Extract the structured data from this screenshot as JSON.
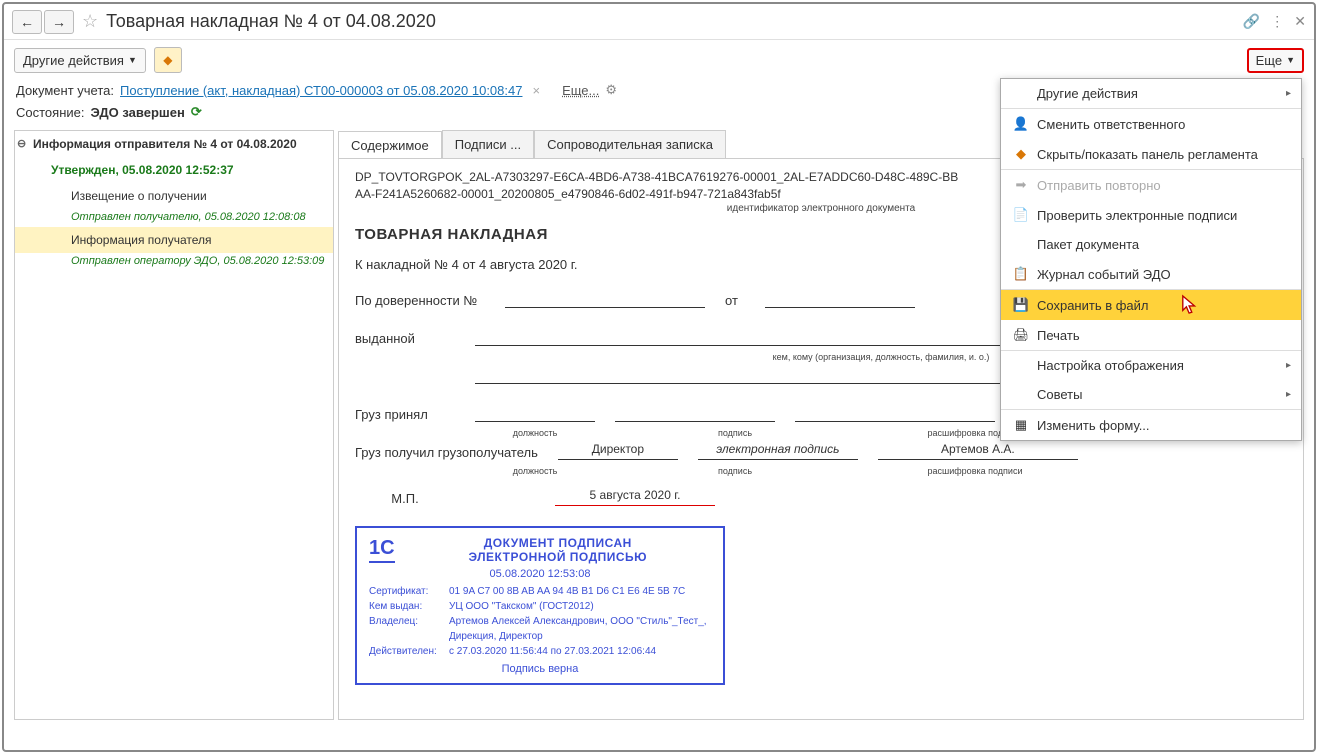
{
  "title": "Товарная накладная № 4 от 04.08.2020",
  "toolbar": {
    "other_actions": "Другие действия",
    "more": "Еще"
  },
  "info": {
    "doc_label": "Документ учета:",
    "doc_link": "Поступление (акт, накладная) СТ00-000003 от 05.08.2020 10:08:47",
    "more": "Еще...",
    "state_label": "Состояние:",
    "state_value": "ЭДО завершен"
  },
  "sidebar": {
    "head": "Информация отправителя № 4 от 04.08.2020",
    "approved": "Утвержден, 05.08.2020 12:52:37",
    "item1": "Извещение о получении",
    "item1_status": "Отправлен получателю, 05.08.2020 12:08:08",
    "item2": "Информация получателя",
    "item2_status": "Отправлен оператору ЭДО, 05.08.2020 12:53:09"
  },
  "tabs": {
    "t1": "Содержимое",
    "t2": "Подписи ...",
    "t3": "Сопроводительная записка"
  },
  "doc": {
    "id_line1": "DP_TOVTORGPOK_2AL-A7303297-E6CA-4BD6-A738-41BCA7619276-00001_2AL-E7ADDC60-D48C-489C-BB",
    "id_line2": "AA-F241A5260682-00001_20200805_e4790846-6d02-491f-b947-721a843fab5f",
    "id_caption": "идентификатор электронного документа",
    "title": "ТОВАРНАЯ НАКЛАДНАЯ",
    "subtitle": "К накладной № 4 от 4 августа 2020 г.",
    "dov_label": "По доверенности №",
    "ot_label": "от",
    "issued_label": "выданной",
    "issued_caption": "кем, кому (организация, должность, фамилия, и. о.)",
    "cargo_accept": "Груз принял",
    "cargo_receive": "Груз получил грузополучатель",
    "cap_position": "должность",
    "cap_sign": "подпись",
    "cap_decrypt": "расшифровка подписи",
    "director": "Директор",
    "esign": "электронная подпись",
    "name": "Артемов А.А.",
    "mp": "М.П.",
    "date": "5 августа 2020 г."
  },
  "sig": {
    "title1": "ДОКУМЕНТ ПОДПИСАН",
    "title2": "ЭЛЕКТРОННОЙ ПОДПИСЬЮ",
    "date": "05.08.2020 12:53:08",
    "cert_k": "Сертификат:",
    "cert_v": "01 9A C7 00 8B AB AA 94 4B B1 D6 C1 E6 4E 5B 7C",
    "issuer_k": "Кем выдан:",
    "issuer_v": "УЦ ООО \"Такском\" (ГОСТ2012)",
    "owner_k": "Владелец:",
    "owner_v": "Артемов Алексей Александрович, ООО \"Стиль\"_Тест_, Дирекция, Директор",
    "valid_k": "Действителен:",
    "valid_v": "с 27.03.2020 11:56:44 по 27.03.2021 12:06:44",
    "ok": "Подпись верна"
  },
  "menu": {
    "m1": "Другие действия",
    "m2": "Сменить ответственного",
    "m3": "Скрыть/показать панель регламента",
    "m4": "Отправить повторно",
    "m5": "Проверить электронные подписи",
    "m6": "Пакет документа",
    "m7": "Журнал событий ЭДО",
    "m8": "Сохранить в файл",
    "m9": "Печать",
    "m10": "Настройка отображения",
    "m11": "Советы",
    "m12": "Изменить форму..."
  }
}
